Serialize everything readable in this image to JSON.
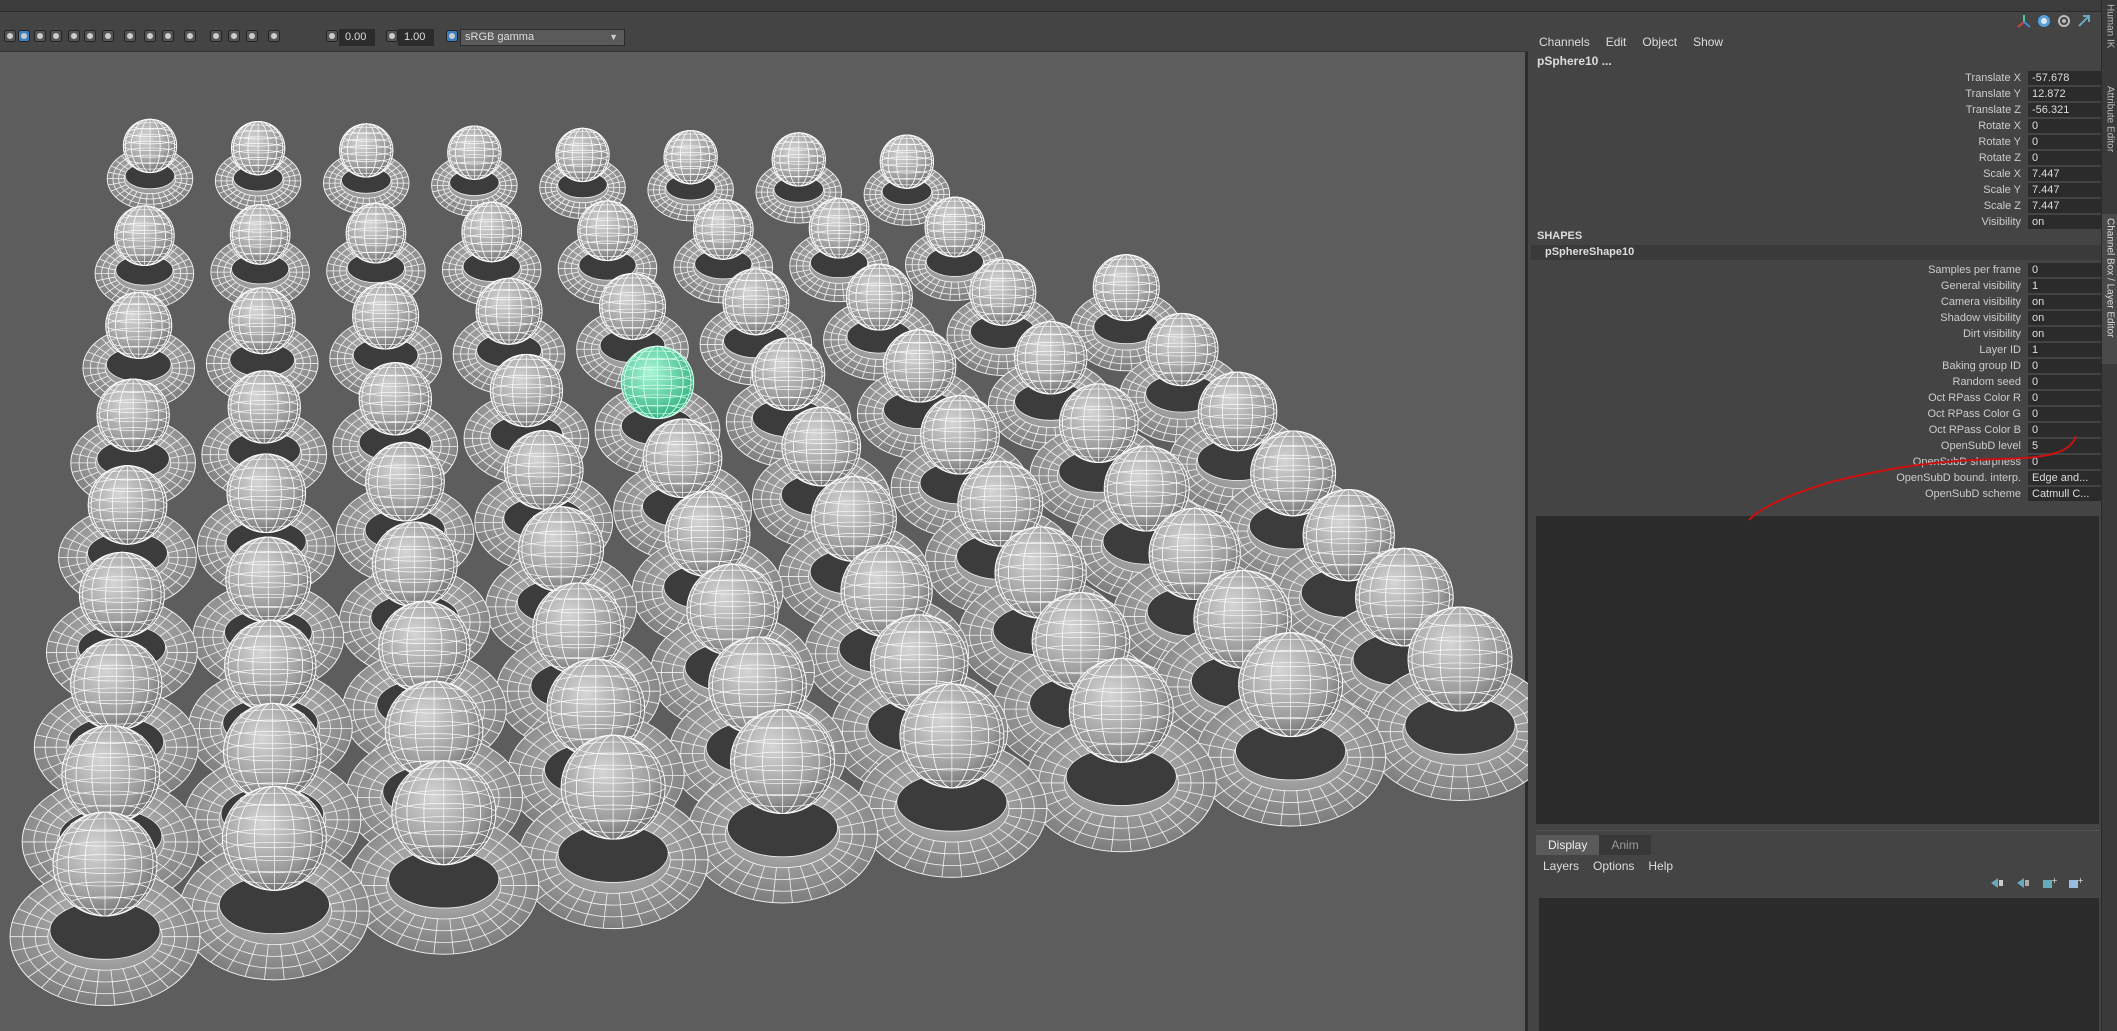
{
  "toolbar": {
    "exposure_value": "0.00",
    "gamma_value": "1.00",
    "colorspace": "sRGB gamma"
  },
  "channelbox": {
    "menu": [
      "Channels",
      "Edit",
      "Object",
      "Show"
    ],
    "object_name": "pSphere10 ...",
    "transform": [
      {
        "label": "Translate X",
        "value": "-57.678"
      },
      {
        "label": "Translate Y",
        "value": "12.872"
      },
      {
        "label": "Translate Z",
        "value": "-56.321"
      },
      {
        "label": "Rotate X",
        "value": "0"
      },
      {
        "label": "Rotate Y",
        "value": "0"
      },
      {
        "label": "Rotate Z",
        "value": "0"
      },
      {
        "label": "Scale X",
        "value": "7.447"
      },
      {
        "label": "Scale Y",
        "value": "7.447"
      },
      {
        "label": "Scale Z",
        "value": "7.447"
      },
      {
        "label": "Visibility",
        "value": "on"
      }
    ],
    "shapes_header": "SHAPES",
    "shape_name": "pSphereShape10",
    "shape_attrs": [
      {
        "label": "Samples per frame",
        "value": "0"
      },
      {
        "label": "General visibility",
        "value": "1"
      },
      {
        "label": "Camera visibility",
        "value": "on"
      },
      {
        "label": "Shadow visibility",
        "value": "on"
      },
      {
        "label": "Dirt visibility",
        "value": "on"
      },
      {
        "label": "Layer ID",
        "value": "1"
      },
      {
        "label": "Baking group ID",
        "value": "0"
      },
      {
        "label": "Random seed",
        "value": "0"
      },
      {
        "label": "Oct RPass Color R",
        "value": "0"
      },
      {
        "label": "Oct RPass Color G",
        "value": "0"
      },
      {
        "label": "Oct RPass Color B",
        "value": "0"
      },
      {
        "label": "OpenSubD level",
        "value": "5"
      },
      {
        "label": "OpenSubD sharpness",
        "value": "0"
      },
      {
        "label": "OpenSubD bound. interp.",
        "value": "Edge and..."
      },
      {
        "label": "OpenSubD scheme",
        "value": "Catmull C..."
      }
    ]
  },
  "layer_editor": {
    "tabs": [
      "Display",
      "Anim"
    ],
    "menu": [
      "Layers",
      "Options",
      "Help"
    ]
  },
  "side_tabs": [
    "Human IK",
    "Attribute Editor",
    "Channel Box / Layer Editor"
  ],
  "colors": {
    "viewport_bg": "#5d5d5d",
    "panel_bg": "#444444",
    "field_bg": "#2b2b2b",
    "selected_object": "#4fd6a0",
    "annotation_line": "#cc1111"
  },
  "scene": {
    "selected_object": "pSphere10",
    "grid_rows": 9,
    "grid_cols": 9
  }
}
